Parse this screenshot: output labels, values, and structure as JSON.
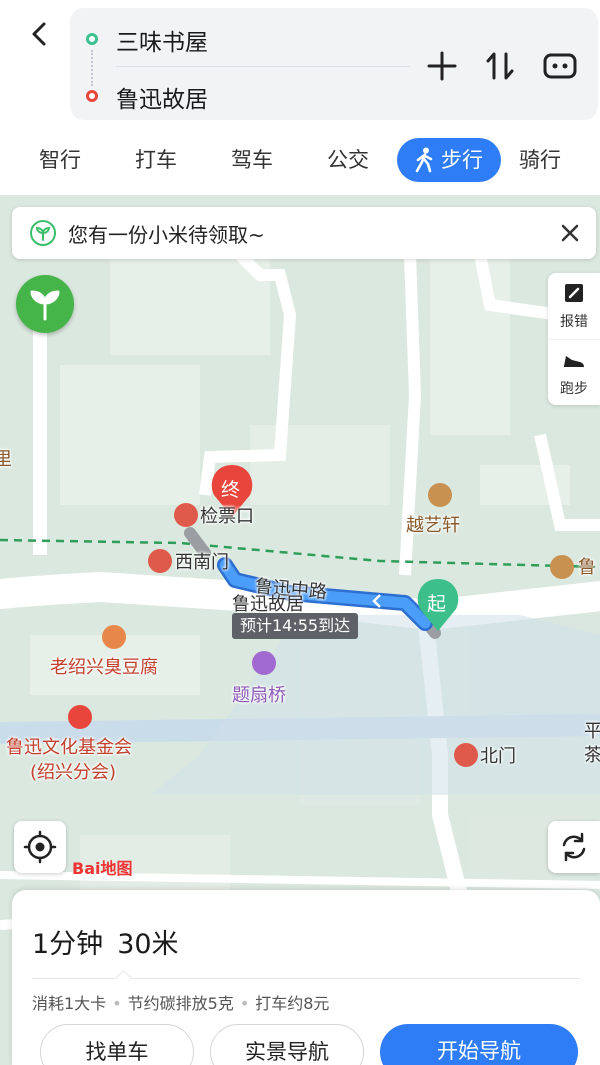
{
  "route": {
    "start": "三味书屋",
    "end": "鲁迅故居"
  },
  "modes": [
    "智行",
    "打车",
    "驾车",
    "公交",
    "步行",
    "骑行"
  ],
  "selected_mode": "步行",
  "accent_color": "#2f7df6",
  "banner": {
    "text": "您有一份小米待领取~"
  },
  "side_tools": {
    "report": "报错",
    "run": "跑步"
  },
  "map": {
    "labels": {
      "jianpiao": "检票口",
      "xinanmen": "西南门",
      "road": "鲁迅中路",
      "destination": "鲁迅故居",
      "yueyixuan": "越艺轩",
      "doufu": "老绍兴臭豆腐",
      "tishanqiao": "题扇桥",
      "foundation_line1": "鲁迅文化基金会",
      "foundation_line2": "(绍兴分会)",
      "beimen": "北门",
      "edge_lu": "鲁",
      "edge_li": "里",
      "edge_ping": "平",
      "edge_cha": "茶"
    },
    "end_marker": "终",
    "start_marker": "起",
    "eta": "预计14:55到达",
    "logo": "Bai地图"
  },
  "summary": {
    "time": "1分钟",
    "distance": "30米",
    "calories": "消耗1大卡",
    "carbon": "节约碳排放5克",
    "taxi": "打车约8元"
  },
  "buttons": {
    "find_bike": "找单车",
    "ar_nav": "实景导航",
    "start_nav": "开始导航"
  }
}
